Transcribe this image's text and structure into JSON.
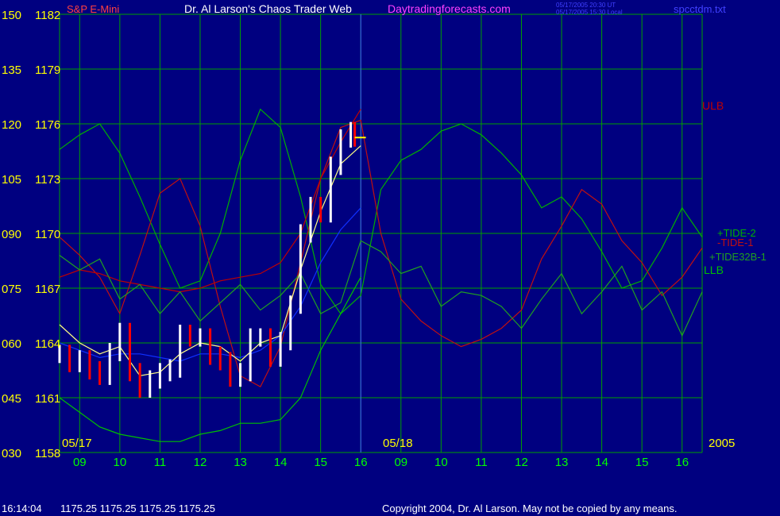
{
  "header": {
    "instrument": "S&P E-Mini",
    "title": "Dr. Al Larson's Chaos Trader Web",
    "site": "Daytradingforecasts.com",
    "stamp_ut": "05/17/2005 20:30 UT",
    "stamp_local": "05/17/2005 15:30 Local",
    "file": "spcctdm.txt"
  },
  "footer": {
    "time": "16:14:04",
    "quote": "1175.25 1175.25 1175.25 1175.25",
    "copyright": "Copyright 2004, Dr. Al Larson. May not be copied by any means."
  },
  "colors": {
    "background": "#000080",
    "grid": "#00a000",
    "axis": "#ffff00",
    "hours": "#00ff00",
    "price_up": "#ffffff",
    "price_down": "#ff0000",
    "title": "#ffffff",
    "site": "#ff40ff",
    "stamp": "#4040ff",
    "ulb": "#c00000",
    "llb": "#00c000",
    "tide2": "#00b000",
    "tide1": "#c01010",
    "tide32b": "#20a020",
    "moving_avg": "#1030ff",
    "fit_line": "#ffff80"
  },
  "chart_data": {
    "type": "line",
    "left_axis": {
      "label": "",
      "ticks": [
        "150",
        "135",
        "120",
        "105",
        "090",
        "075",
        "060",
        "045",
        "030"
      ],
      "range": [
        30,
        150
      ]
    },
    "price_axis": {
      "label": "",
      "ticks": [
        "1182",
        "1179",
        "1176",
        "1173",
        "1170",
        "1167",
        "1164",
        "1161",
        "1158"
      ],
      "range": [
        1158,
        1182
      ]
    },
    "x_axis": {
      "hour_ticks": [
        "09",
        "10",
        "11",
        "12",
        "13",
        "14",
        "15",
        "16",
        "09",
        "10",
        "11",
        "12",
        "13",
        "14",
        "15",
        "16"
      ],
      "date_labels": [
        "05/17",
        "05/18"
      ],
      "year_label": "2005",
      "range_hours": [
        8.5,
        24.5
      ]
    },
    "series": [
      {
        "name": "+TIDE-2",
        "color_key": "tide2",
        "x": [
          8.5,
          9.0,
          9.5,
          10.0,
          10.5,
          11.0,
          11.5,
          12.0,
          12.5,
          13.0,
          13.5,
          14.0,
          14.5,
          15.0,
          15.5,
          16.0,
          16.5,
          17.0,
          17.5,
          18.0,
          18.5,
          19.0,
          19.5,
          20.0,
          20.5,
          21.0,
          21.5,
          22.0,
          22.5,
          23.0,
          23.5,
          24.0,
          24.5
        ],
        "y": [
          113,
          117,
          120,
          112,
          100,
          87,
          75,
          77,
          90,
          110,
          124,
          119,
          100,
          76,
          68,
          73,
          102,
          110,
          113,
          118,
          120,
          117,
          112,
          106,
          97,
          100,
          94,
          85,
          75,
          77,
          86,
          97,
          89
        ]
      },
      {
        "name": "-TIDE-1",
        "color_key": "tide1",
        "x": [
          8.5,
          9.0,
          9.5,
          10.0,
          10.5,
          11.0,
          11.5,
          12.0,
          12.5,
          13.0,
          13.5,
          14.0,
          14.5,
          15.0,
          15.5,
          16.0,
          16.5,
          17.0,
          17.5,
          18.0,
          18.5,
          19.0,
          19.5,
          20.0,
          20.5,
          21.0,
          21.5,
          22.0,
          22.5,
          23.0,
          23.5,
          24.0,
          24.5
        ],
        "y": [
          89,
          84,
          78,
          68,
          84,
          101,
          105,
          92,
          70,
          51,
          48,
          59,
          82,
          105,
          119,
          121,
          90,
          72,
          66,
          62,
          59,
          61,
          64,
          69,
          83,
          92,
          102,
          98,
          88,
          82,
          73,
          78,
          86
        ]
      },
      {
        "name": "ULB",
        "color_key": "ulb",
        "x": [
          8.5,
          9.0,
          9.5,
          10.0,
          10.5,
          11.0,
          11.5,
          12.0,
          12.5,
          13.0,
          13.5,
          14.0,
          14.5,
          15.0,
          15.5,
          16.0
        ],
        "y": [
          78,
          80,
          79,
          77,
          76,
          75,
          74,
          75,
          77,
          78,
          79,
          82,
          90,
          105,
          115,
          124
        ]
      },
      {
        "name": "LLB",
        "color_key": "llb",
        "x": [
          8.5,
          9.0,
          9.5,
          10.0,
          10.5,
          11.0,
          11.5,
          12.0,
          12.5,
          13.0,
          13.5,
          14.0,
          14.5,
          15.0,
          15.5,
          16.0
        ],
        "y": [
          45,
          41,
          37,
          35,
          34,
          33,
          33,
          35,
          36,
          38,
          38,
          39,
          45,
          58,
          68,
          78
        ]
      },
      {
        "name": "+TIDE32B-1",
        "color_key": "tide32b",
        "x": [
          8.5,
          9.0,
          9.5,
          10.0,
          10.5,
          11.0,
          11.5,
          12.0,
          12.5,
          13.0,
          13.5,
          14.0,
          14.5,
          15.0,
          15.5,
          16.0,
          16.5,
          17.0,
          17.5,
          18.0,
          18.5,
          19.0,
          19.5,
          20.0,
          20.5,
          21.0,
          21.5,
          22.0,
          22.5,
          23.0,
          23.5,
          24.0,
          24.5
        ],
        "y": [
          84,
          80,
          83,
          72,
          76,
          68,
          74,
          66,
          71,
          76,
          69,
          73,
          79,
          68,
          71,
          88,
          85,
          79,
          81,
          70,
          74,
          73,
          70,
          64,
          72,
          79,
          68,
          74,
          81,
          69,
          74,
          62,
          74
        ]
      },
      {
        "name": "",
        "color_key": "moving_avg",
        "x": [
          8.5,
          9.0,
          9.5,
          10.0,
          10.5,
          11.0,
          11.5,
          12.0,
          12.5,
          13.0,
          13.5,
          14.0,
          14.5,
          15.0,
          15.5,
          16.0
        ],
        "y": [
          60,
          58,
          56,
          57,
          57,
          56,
          55,
          57,
          57,
          56,
          58,
          62,
          70,
          82,
          91,
          97
        ]
      },
      {
        "name": "",
        "color_key": "fit_line",
        "x": [
          8.5,
          9.0,
          9.5,
          10.0,
          10.5,
          11.0,
          11.5,
          12.0,
          12.5,
          13.0,
          13.5,
          14.0,
          14.5,
          15.0,
          15.5,
          16.0
        ],
        "y": [
          65,
          60,
          57,
          59,
          51,
          52,
          57,
          60,
          59,
          55,
          60,
          62,
          80,
          96,
          109,
          114
        ]
      }
    ],
    "price_bars": {
      "x": [
        8.5,
        8.75,
        9.0,
        9.25,
        9.5,
        9.75,
        10.0,
        10.25,
        10.5,
        10.75,
        11.0,
        11.25,
        11.5,
        11.75,
        12.0,
        12.25,
        12.5,
        12.75,
        13.0,
        13.25,
        13.5,
        13.75,
        14.0,
        14.25,
        14.5,
        14.75,
        15.0,
        15.25,
        15.5,
        15.75,
        15.85
      ],
      "close": [
        1163.4,
        1162.9,
        1163.1,
        1162.5,
        1162.2,
        1163.5,
        1164.6,
        1162.4,
        1161.5,
        1162.0,
        1162.4,
        1162.6,
        1164.5,
        1164.3,
        1164.3,
        1163.3,
        1163.0,
        1162.1,
        1162.4,
        1164.3,
        1164.3,
        1163.2,
        1164.1,
        1166.1,
        1170.0,
        1171.5,
        1171.1,
        1173.7,
        1175.2,
        1175.6,
        1175.25
      ],
      "spread": 0.5
    }
  },
  "series_labels": {
    "ulb": "ULB",
    "tide2": "+TIDE-2",
    "tide1": "-TIDE-1",
    "tide32b": "+TIDE32B-1",
    "llb": "LLB"
  }
}
